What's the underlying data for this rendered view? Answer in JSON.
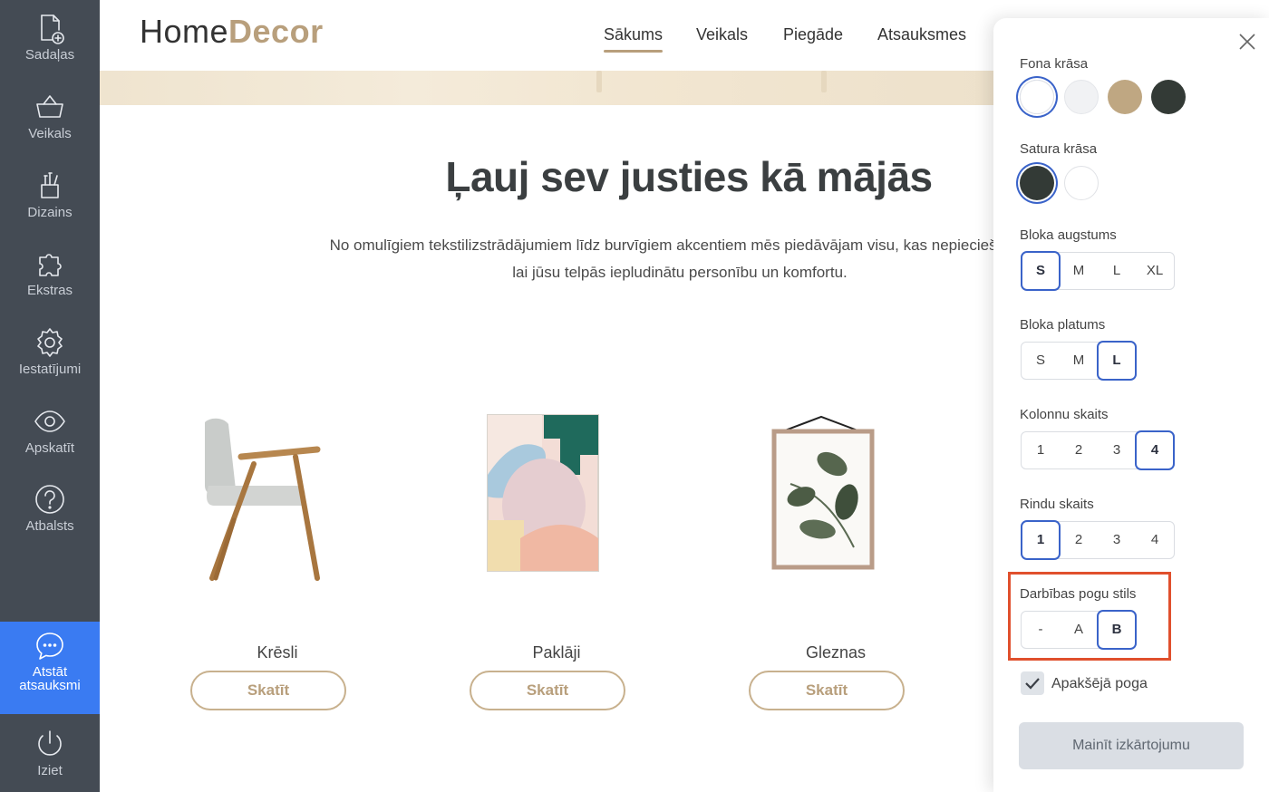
{
  "sidebar": {
    "items": [
      {
        "label": "Sadaļas",
        "icon": "add-page-icon"
      },
      {
        "label": "Veikals",
        "icon": "basket-icon"
      },
      {
        "label": "Dizains",
        "icon": "brush-cup-icon"
      },
      {
        "label": "Ekstras",
        "icon": "puzzle-icon"
      },
      {
        "label": "Iestatījumi",
        "icon": "gear-icon"
      },
      {
        "label": "Apskatīt",
        "icon": "eye-icon"
      },
      {
        "label": "Atbalsts",
        "icon": "help-icon"
      }
    ],
    "feedback": {
      "line1": "Atstāt",
      "line2": "atsauksmi",
      "icon": "chat-bubble-icon"
    },
    "exit": {
      "label": "Iziet",
      "icon": "power-icon"
    }
  },
  "header": {
    "logo_part1": "Home",
    "logo_part2": "Decor",
    "nav": [
      "Sākums",
      "Veikals",
      "Piegāde",
      "Atsauksmes"
    ],
    "active_nav": "Sākums"
  },
  "main": {
    "title": "Ļauj sev justies kā mājās",
    "desc_line1": "No omulīgiem tekstilizstrādājumiem līdz burvīgiem akcentiem mēs piedāvājam visu, kas nepieciešams,",
    "desc_line2": "lai jūsu telpās iepludinātu personību un komfortu.",
    "products": [
      {
        "name": "Krēsli",
        "button": "Skatīt"
      },
      {
        "name": "Paklāji",
        "button": "Skatīt"
      },
      {
        "name": "Gleznas",
        "button": "Skatīt"
      }
    ]
  },
  "panel": {
    "bg_color_label": "Fona krāsa",
    "bg_colors": [
      "#ffffff",
      "#f1f2f4",
      "#bfa782",
      "#333a36"
    ],
    "bg_selected": 0,
    "content_color_label": "Satura krāsa",
    "content_colors": [
      "#333a36",
      "#ffffff"
    ],
    "content_selected": 0,
    "height_label": "Bloka augstums",
    "height_options": [
      "S",
      "M",
      "L",
      "XL"
    ],
    "height_selected": "S",
    "width_label": "Bloka platums",
    "width_options": [
      "S",
      "M",
      "L"
    ],
    "width_selected": "L",
    "columns_label": "Kolonnu skaits",
    "columns_options": [
      "1",
      "2",
      "3",
      "4"
    ],
    "columns_selected": "4",
    "rows_label": "Rindu skaits",
    "rows_options": [
      "1",
      "2",
      "3",
      "4"
    ],
    "rows_selected": "1",
    "button_style_label": "Darbības pogu stils",
    "button_style_options": [
      "-",
      "A",
      "B"
    ],
    "button_style_selected": "B",
    "bottom_button_label": "Apakšējā poga",
    "bottom_button_checked": true,
    "apply_label": "Mainīt izkārtojumu"
  },
  "colors": {
    "accent": "#b89f7c",
    "sidebar_bg": "#444b54",
    "feedback_bg": "#3a7bf2",
    "selection": "#3a63c9",
    "highlight": "#e0502d"
  }
}
